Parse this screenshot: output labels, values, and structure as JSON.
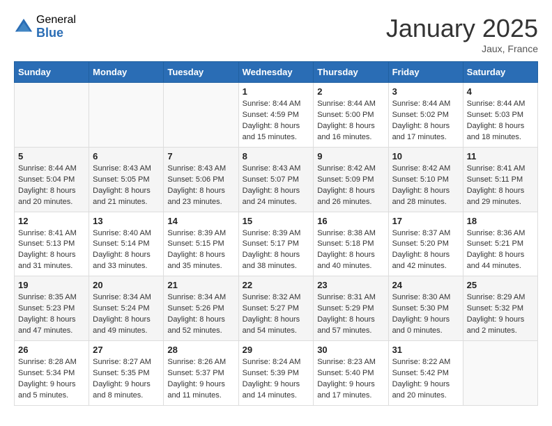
{
  "logo": {
    "general": "General",
    "blue": "Blue"
  },
  "title": "January 2025",
  "location": "Jaux, France",
  "days_header": [
    "Sunday",
    "Monday",
    "Tuesday",
    "Wednesday",
    "Thursday",
    "Friday",
    "Saturday"
  ],
  "weeks": [
    [
      {
        "day": "",
        "info": ""
      },
      {
        "day": "",
        "info": ""
      },
      {
        "day": "",
        "info": ""
      },
      {
        "day": "1",
        "info": "Sunrise: 8:44 AM\nSunset: 4:59 PM\nDaylight: 8 hours\nand 15 minutes."
      },
      {
        "day": "2",
        "info": "Sunrise: 8:44 AM\nSunset: 5:00 PM\nDaylight: 8 hours\nand 16 minutes."
      },
      {
        "day": "3",
        "info": "Sunrise: 8:44 AM\nSunset: 5:02 PM\nDaylight: 8 hours\nand 17 minutes."
      },
      {
        "day": "4",
        "info": "Sunrise: 8:44 AM\nSunset: 5:03 PM\nDaylight: 8 hours\nand 18 minutes."
      }
    ],
    [
      {
        "day": "5",
        "info": "Sunrise: 8:44 AM\nSunset: 5:04 PM\nDaylight: 8 hours\nand 20 minutes."
      },
      {
        "day": "6",
        "info": "Sunrise: 8:43 AM\nSunset: 5:05 PM\nDaylight: 8 hours\nand 21 minutes."
      },
      {
        "day": "7",
        "info": "Sunrise: 8:43 AM\nSunset: 5:06 PM\nDaylight: 8 hours\nand 23 minutes."
      },
      {
        "day": "8",
        "info": "Sunrise: 8:43 AM\nSunset: 5:07 PM\nDaylight: 8 hours\nand 24 minutes."
      },
      {
        "day": "9",
        "info": "Sunrise: 8:42 AM\nSunset: 5:09 PM\nDaylight: 8 hours\nand 26 minutes."
      },
      {
        "day": "10",
        "info": "Sunrise: 8:42 AM\nSunset: 5:10 PM\nDaylight: 8 hours\nand 28 minutes."
      },
      {
        "day": "11",
        "info": "Sunrise: 8:41 AM\nSunset: 5:11 PM\nDaylight: 8 hours\nand 29 minutes."
      }
    ],
    [
      {
        "day": "12",
        "info": "Sunrise: 8:41 AM\nSunset: 5:13 PM\nDaylight: 8 hours\nand 31 minutes."
      },
      {
        "day": "13",
        "info": "Sunrise: 8:40 AM\nSunset: 5:14 PM\nDaylight: 8 hours\nand 33 minutes."
      },
      {
        "day": "14",
        "info": "Sunrise: 8:39 AM\nSunset: 5:15 PM\nDaylight: 8 hours\nand 35 minutes."
      },
      {
        "day": "15",
        "info": "Sunrise: 8:39 AM\nSunset: 5:17 PM\nDaylight: 8 hours\nand 38 minutes."
      },
      {
        "day": "16",
        "info": "Sunrise: 8:38 AM\nSunset: 5:18 PM\nDaylight: 8 hours\nand 40 minutes."
      },
      {
        "day": "17",
        "info": "Sunrise: 8:37 AM\nSunset: 5:20 PM\nDaylight: 8 hours\nand 42 minutes."
      },
      {
        "day": "18",
        "info": "Sunrise: 8:36 AM\nSunset: 5:21 PM\nDaylight: 8 hours\nand 44 minutes."
      }
    ],
    [
      {
        "day": "19",
        "info": "Sunrise: 8:35 AM\nSunset: 5:23 PM\nDaylight: 8 hours\nand 47 minutes."
      },
      {
        "day": "20",
        "info": "Sunrise: 8:34 AM\nSunset: 5:24 PM\nDaylight: 8 hours\nand 49 minutes."
      },
      {
        "day": "21",
        "info": "Sunrise: 8:34 AM\nSunset: 5:26 PM\nDaylight: 8 hours\nand 52 minutes."
      },
      {
        "day": "22",
        "info": "Sunrise: 8:32 AM\nSunset: 5:27 PM\nDaylight: 8 hours\nand 54 minutes."
      },
      {
        "day": "23",
        "info": "Sunrise: 8:31 AM\nSunset: 5:29 PM\nDaylight: 8 hours\nand 57 minutes."
      },
      {
        "day": "24",
        "info": "Sunrise: 8:30 AM\nSunset: 5:30 PM\nDaylight: 9 hours\nand 0 minutes."
      },
      {
        "day": "25",
        "info": "Sunrise: 8:29 AM\nSunset: 5:32 PM\nDaylight: 9 hours\nand 2 minutes."
      }
    ],
    [
      {
        "day": "26",
        "info": "Sunrise: 8:28 AM\nSunset: 5:34 PM\nDaylight: 9 hours\nand 5 minutes."
      },
      {
        "day": "27",
        "info": "Sunrise: 8:27 AM\nSunset: 5:35 PM\nDaylight: 9 hours\nand 8 minutes."
      },
      {
        "day": "28",
        "info": "Sunrise: 8:26 AM\nSunset: 5:37 PM\nDaylight: 9 hours\nand 11 minutes."
      },
      {
        "day": "29",
        "info": "Sunrise: 8:24 AM\nSunset: 5:39 PM\nDaylight: 9 hours\nand 14 minutes."
      },
      {
        "day": "30",
        "info": "Sunrise: 8:23 AM\nSunset: 5:40 PM\nDaylight: 9 hours\nand 17 minutes."
      },
      {
        "day": "31",
        "info": "Sunrise: 8:22 AM\nSunset: 5:42 PM\nDaylight: 9 hours\nand 20 minutes."
      },
      {
        "day": "",
        "info": ""
      }
    ]
  ]
}
